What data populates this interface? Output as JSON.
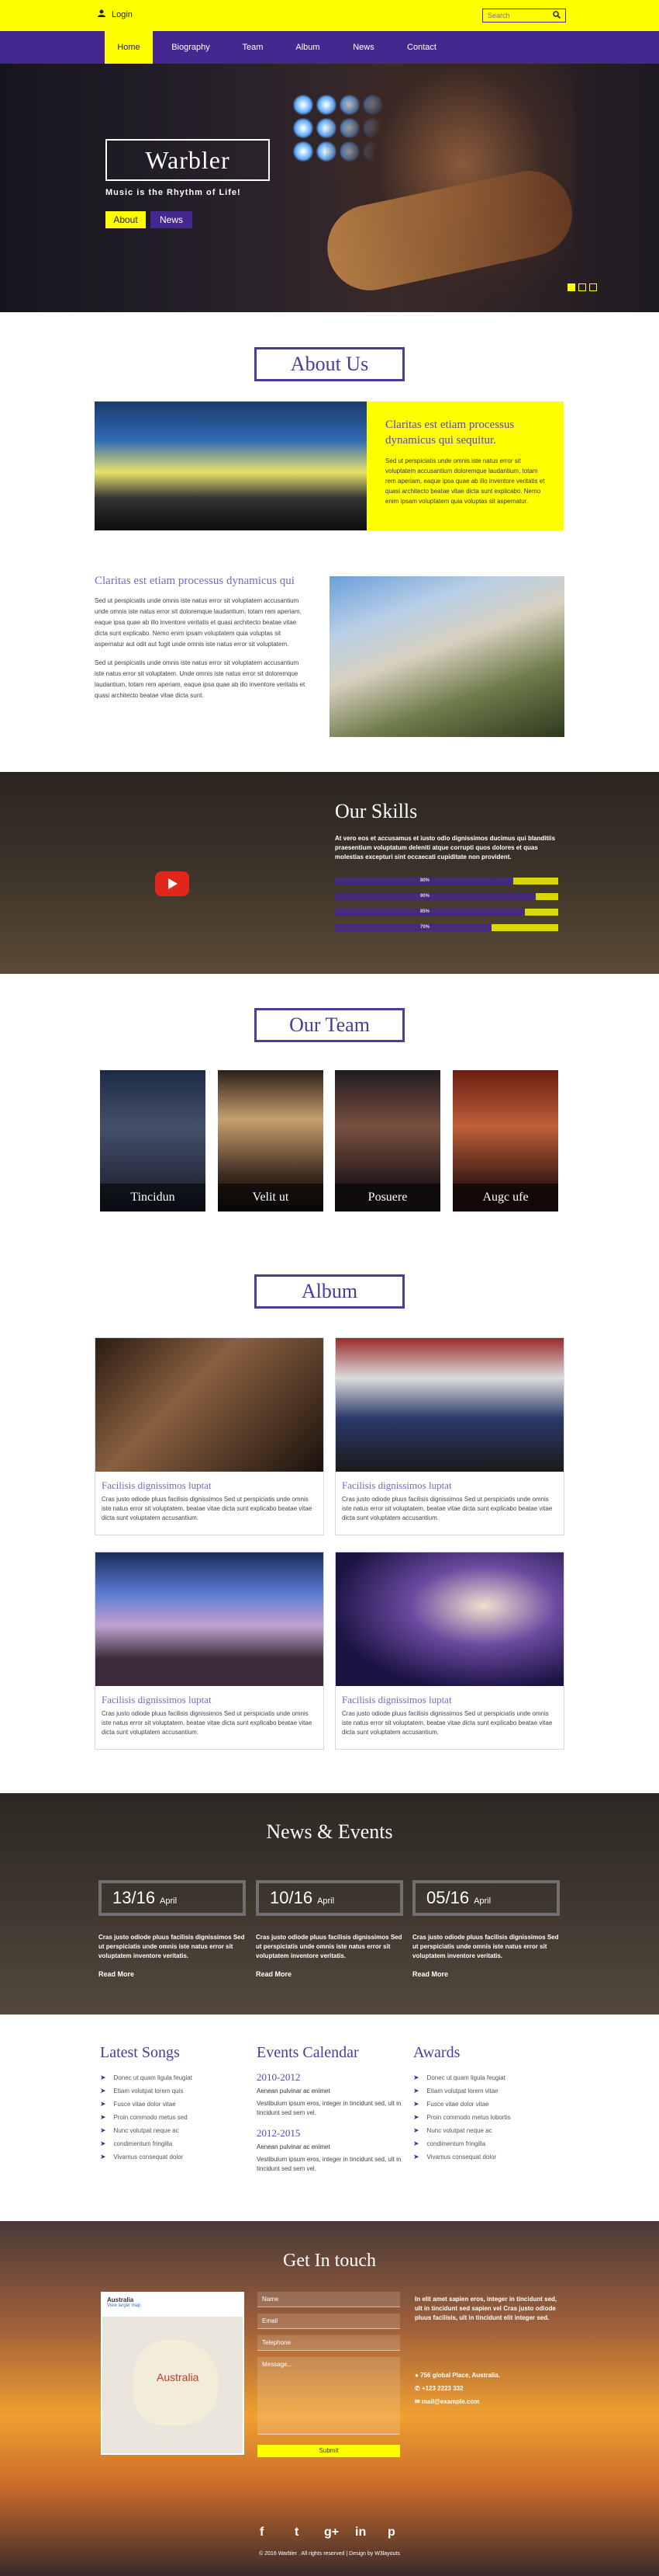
{
  "topbar": {
    "login": "Login",
    "search_placeholder": "Search"
  },
  "nav": {
    "items": [
      "Home",
      "Biography",
      "Team",
      "Album",
      "News",
      "Contact"
    ]
  },
  "hero": {
    "brand": "Warbler",
    "tagline": "Music is the Rhythm of Life!",
    "btn_about": "About",
    "btn_news": "News"
  },
  "about": {
    "heading": "About Us",
    "yellow_title": "Claritas est etiam processus dynamicus qui sequitur.",
    "yellow_text": "Sed ut perspiciatis unde omnis iste natus error sit voluptatem accusantium doloremque laudantium, totam rem aperiam, eaque ipsa quae ab illo inventore veritatis et quasi architecto beatae vitae dicta sunt explicabo. Nemo enim ipsam voluptatem quia voluptas sit aspernatur.",
    "text_title": "Claritas est etiam processus dynamicus qui",
    "text_p1": "Sed ut perspiciatis unde omnis iste natus error sit voluptatem accusantium unde omnis iste natus error sit doloremque laudantium, totam rem aperiam, eaque ipsa quae ab illo inventore veritatis et quasi architecto beatae vitae dicta sunt explicabo. Nemo enim ipsam voluptatem quia voluptas sit aspernatur aut odit aut fugit unde omnis iste natus error sit voluptatem.",
    "text_p2": "Sed ut perspiciatis unde omnis iste natus error sit voluptatem accusantium iste natus error sit voluptatem. Unde omnis iste natus error sit doloremque laudantium, totam rem aperiam, eaque ipsa quae ab illo inventore veritatis et quasi architecto beatae vitae dicta sunt."
  },
  "skills": {
    "heading": "Our Skills",
    "text": "At vero eos et accusamus et iusto odio dignissimos ducimus qui blanditiis praesentium voluptatum deleniti atque corrupti quos dolores et quas molestias excepturi sint occaecati cupiditate non provident.",
    "bars": [
      {
        "label": "80%",
        "value": 80
      },
      {
        "label": "90%",
        "value": 90
      },
      {
        "label": "85%",
        "value": 85
      },
      {
        "label": "70%",
        "value": 70
      }
    ]
  },
  "team": {
    "heading": "Our Team",
    "members": [
      "Tincidun",
      "Velit ut",
      "Posuere",
      "Augc ufe"
    ]
  },
  "album": {
    "heading": "Album",
    "cards": [
      {
        "title": "Facilisis dignissimos luptat",
        "text": "Cras justo odiode pluus facilisis dignissimos Sed ut perspiciatis unde omnis iste natus error sit voluptatem, beatae vitae dicta sunt explicabo beatae vitae dicta sunt voluptatem accusantium."
      },
      {
        "title": "Facilisis dignissimos luptat",
        "text": "Cras justo odiode pluus facilisis dignissimos Sed ut perspiciatis unde omnis iste natus error sit voluptatem, beatae vitae dicta sunt explicabo beatae vitae dicta sunt voluptatem accusantium."
      },
      {
        "title": "Facilisis dignissimos luptat",
        "text": "Cras justo odiode pluus facilisis dignissimos Sed ut perspiciatis unde omnis iste natus error sit voluptatem, beatae vitae dicta sunt explicabo beatae vitae dicta sunt voluptatem accusantium."
      },
      {
        "title": "Facilisis dignissimos luptat",
        "text": "Cras justo odiode pluus facilisis dignissimos Sed ut perspiciatis unde omnis iste natus error sit voluptatem, beatae vitae dicta sunt explicabo beatae vitae dicta sunt voluptatem accusantium."
      }
    ]
  },
  "news": {
    "heading": "News & Events",
    "items": [
      {
        "day": "13/16",
        "month": "April",
        "text": "Cras justo odiode pluus facilisis dignissimos Sed ut perspiciatis unde omnis iste natus error sit voluptatem inventore veritatis.",
        "more": "Read More"
      },
      {
        "day": "10/16",
        "month": "April",
        "text": "Cras justo odiode pluus facilisis dignissimos Sed ut perspiciatis unde omnis iste natus error sit voluptatem inventore veritatis.",
        "more": "Read More"
      },
      {
        "day": "05/16",
        "month": "April",
        "text": "Cras justo odiode pluus facilisis dignissimos Sed ut perspiciatis unde omnis iste natus error sit voluptatem inventore veritatis.",
        "more": "Read More"
      }
    ]
  },
  "latest_songs": {
    "heading": "Latest Songs",
    "items": [
      "Donec ut quam ligula feugiat",
      "Etiam volutpat lorem quis",
      "Fusce vitae dolor vitae",
      "Proin commodo metus sed",
      "Nunc volutpat neque ac",
      "condimentum fringilla",
      "Vivamus consequat dolor"
    ]
  },
  "events": {
    "heading": "Events Calendar",
    "items": [
      {
        "year": "2010-2012",
        "title": "Aenean pulvinar ac enimet",
        "text": "Vestibulum ipsum eros, integer in tincidunt sed, ult in tincidunt sed sem vel."
      },
      {
        "year": "2012-2015",
        "title": "Aenean pulvinar ac enimet",
        "text": "Vestibulum ipsum eros, integer in tincidunt sed, ult in tincidunt sed sem vel."
      }
    ]
  },
  "awards": {
    "heading": "Awards",
    "items": [
      "Donec ut quam ligula feugiat",
      "Etiam volutpat lorem vitae",
      "Fusce vitae dolor vitae",
      "Proin commodo metus lobortis",
      "Nunc volutpat neque ac",
      "condimentum fringilla",
      "Vivamus consequat dolor"
    ]
  },
  "contact": {
    "heading": "Get In touch",
    "map_place": "Australia",
    "map_link": "View larger map",
    "map_label": "Australia",
    "fields": [
      "Name",
      "Email",
      "Telephone",
      "Message..."
    ],
    "submit": "Submit",
    "about": "In elit amet sapien eros, integer in tincidunt sed, ult in tincidunt sed sapien vel Cras justo odiode pluus facilisis, ult in tincidunt elit integer sed.",
    "address": "756 global Place, Australia.",
    "phone": "+123 2223 332",
    "email": "mail@example.com"
  },
  "footer": {
    "copyright": "© 2016 Warbler . All rights reserved | Design by W3layouts"
  },
  "colors": {
    "yellow": "#ffff00",
    "purple": "#44288f",
    "accent": "#4b3b9a"
  }
}
